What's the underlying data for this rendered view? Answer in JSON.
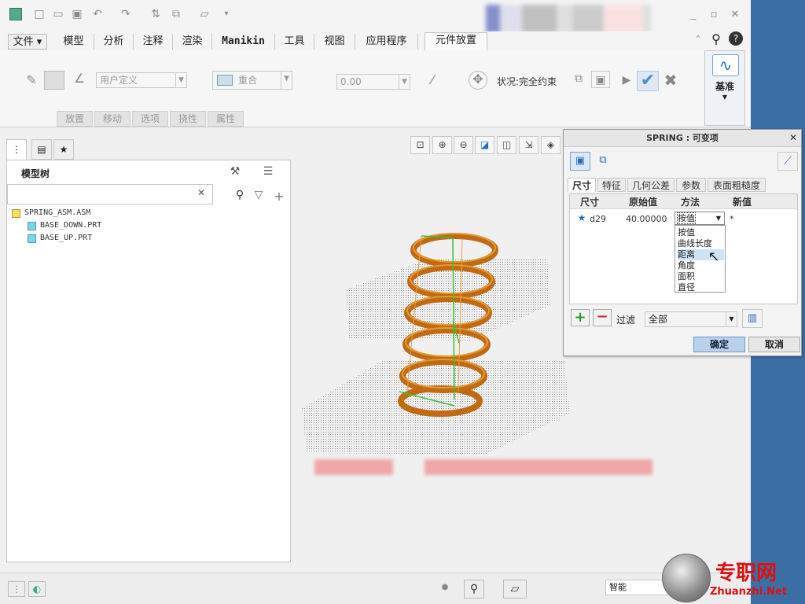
{
  "ribbon": {
    "tabs": [
      "文件",
      "模型",
      "分析",
      "注释",
      "渲染",
      "Manikin",
      "工具",
      "视图",
      "应用程序",
      "元件放置"
    ],
    "user_defined": "用户定义",
    "constraint": "重合",
    "offset_value": "0.00",
    "status": "状况:完全约束",
    "datum": "基准",
    "subtabs": [
      "放置",
      "移动",
      "选项",
      "挠性",
      "属性"
    ]
  },
  "model_tree": {
    "title": "模型树",
    "items": [
      "SPRING_ASM.ASM",
      "BASE_DOWN.PRT",
      "BASE_UP.PRT"
    ]
  },
  "dialog": {
    "title": "SPRING : 可变项",
    "tabs": [
      "尺寸",
      "特征",
      "几何公差",
      "参数",
      "表面粗糙度"
    ],
    "columns": [
      "尺寸",
      "原始值",
      "方法",
      "新值"
    ],
    "row": {
      "dim": "d29",
      "orig": "40.00000",
      "method": "按值",
      "new": "*"
    },
    "method_options": [
      "按值",
      "曲线长度",
      "距离",
      "角度",
      "面积",
      "直径"
    ],
    "highlighted_option": "距离",
    "filter_label": "过滤",
    "filter_value": "全部",
    "ok": "确定",
    "cancel": "取消"
  },
  "status": {
    "smart": "智能"
  },
  "watermark": {
    "text": "专职网",
    "url": "Zhuanzhi.Net"
  },
  "colors": {
    "spring": "#c06a14",
    "accent": "#3a6ea5"
  }
}
